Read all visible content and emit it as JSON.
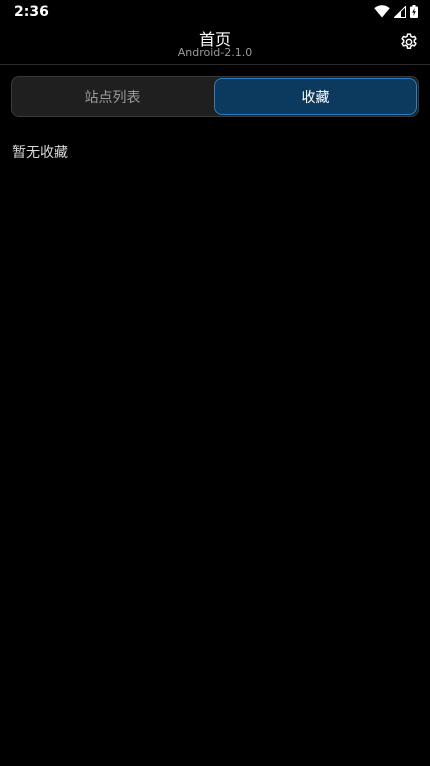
{
  "status_bar": {
    "time": "2:36",
    "icons": [
      "wifi-icon",
      "signal-icon",
      "battery-icon"
    ]
  },
  "app_bar": {
    "title": "首页",
    "subtitle": "Android-2.1.0",
    "settings_icon": "gear-icon"
  },
  "tabs": [
    {
      "label": "站点列表",
      "selected": false
    },
    {
      "label": "收藏",
      "selected": true
    }
  ],
  "content": {
    "empty_message": "暂无收藏"
  },
  "colors": {
    "background": "#000000",
    "tab_active_bg": "#0c3a5e",
    "tab_active_border": "#2a7fc4",
    "tab_bar_bg": "#1f1f1f"
  }
}
